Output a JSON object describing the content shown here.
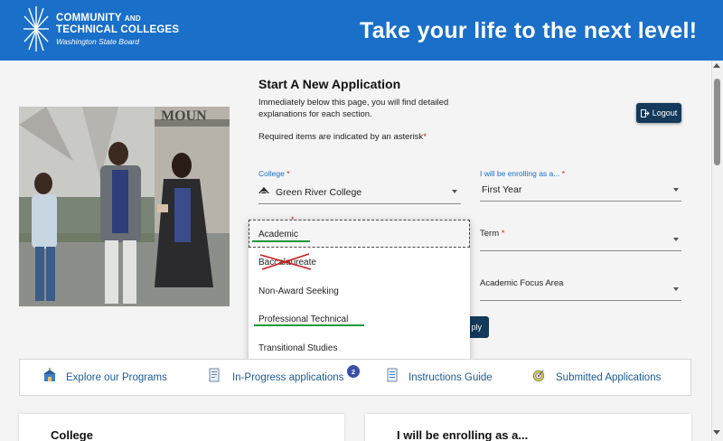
{
  "header": {
    "logo_line1": "COMMUNITY",
    "logo_line1_small": "AND",
    "logo_line2": "TECHNICAL COLLEGES",
    "logo_line3": "Washington State Board",
    "tagline": "Take your life to the next level!"
  },
  "form": {
    "title": "Start A New Application",
    "description": "Immediately below this page, you will find detailed explanations for each section.",
    "required_note": "Required items are indicated by an asterisk",
    "required_star": "*",
    "logout_label": "Logout",
    "college": {
      "label": "College",
      "star": "*",
      "value": "Green River College"
    },
    "enrolling": {
      "label": "I will be enrolling as a...",
      "star": "*",
      "value": "First Year"
    },
    "term": {
      "label": "Term",
      "star": "*"
    },
    "focus_area": {
      "label": "Academic Focus Area"
    },
    "apply_label": "ply"
  },
  "dropdown": {
    "options": [
      "Academic",
      "Baccalaureate",
      "Non-Award Seeking",
      "Professional Technical",
      "Transitional Studies"
    ],
    "selected": "Academic",
    "crossed_out": "Baccalaureate"
  },
  "nav": {
    "items": [
      {
        "label": "Explore our Programs",
        "icon": "school-icon"
      },
      {
        "label": "In-Progress applications",
        "icon": "document-icon",
        "badge": "2"
      },
      {
        "label": "Instructions Guide",
        "icon": "guide-icon"
      },
      {
        "label": "Submitted Applications",
        "icon": "target-icon"
      }
    ]
  },
  "cards": {
    "college_title": "College",
    "enrolling_title": "I will be enrolling as a..."
  },
  "colors": {
    "header_blue": "#1a6fc9",
    "button_navy": "#14395a",
    "link_blue": "#1a5b99",
    "required_red": "#d01b1b",
    "annotation_green": "#1e9a3a",
    "annotation_red": "#c81e1e"
  }
}
